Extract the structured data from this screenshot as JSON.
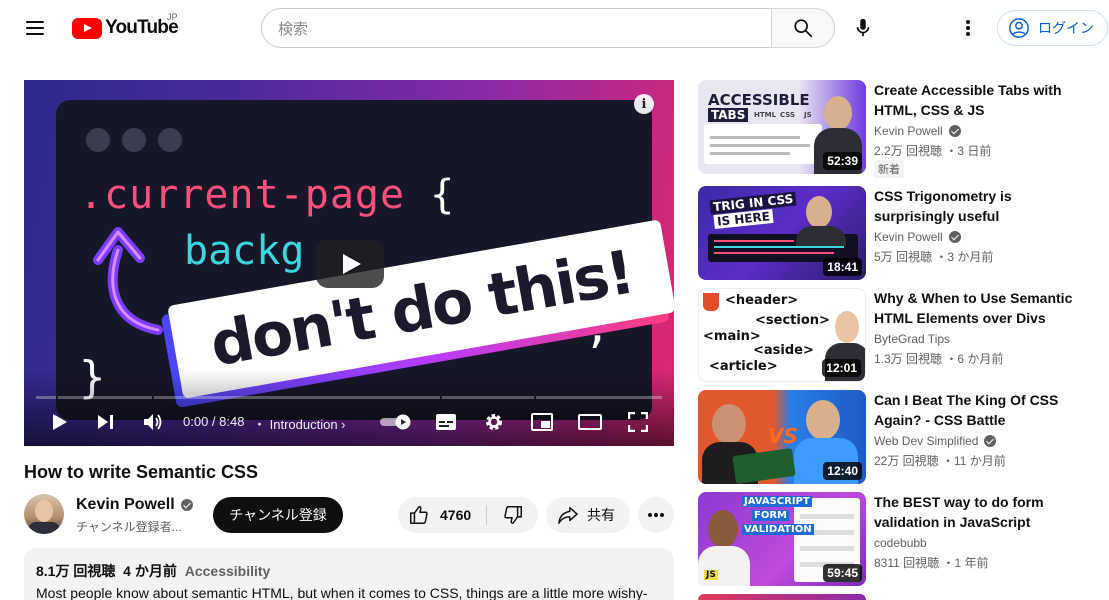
{
  "header": {
    "logo_text": "YouTube",
    "logo_region": "JP",
    "search_placeholder": "検索",
    "login_label": "ログイン"
  },
  "player": {
    "code_line1": ".current-page",
    "code_brace_open": "{",
    "code_line2": "backg",
    "code_semicolon": ";",
    "code_brace_close": "}",
    "banner_text": "don't do this!",
    "time_current": "0:00",
    "time_total": "8:48",
    "time_display": "0:00 / 8:48",
    "chapter": "Introduction",
    "info_label": "i",
    "progress_fraction": 0
  },
  "video": {
    "title": "How to write Semantic CSS",
    "channel_name": "Kevin Powell",
    "channel_subs": "チャンネル登録者...",
    "subscribe_label": "チャンネル登録",
    "likes": "4760",
    "share_label": "共有",
    "views": "8.1万 回視聴",
    "age": "4 か月前",
    "tag": "Accessibility",
    "description": "Most people know about semantic HTML, but when it comes to CSS, things are a little more wishy-"
  },
  "recommendations": [
    {
      "title": "Create Accessible Tabs with HTML, CSS & JS",
      "channel": "Kevin Powell",
      "verified": true,
      "meta": "2.2万 回視聴 ・3 日前",
      "badge": "新着",
      "duration": "52:39",
      "thumb_text": [
        "ACCESSIBLE",
        "TABS",
        "HTML",
        "CSS",
        "JS"
      ]
    },
    {
      "title": "CSS Trigonometry is surprisingly useful",
      "channel": "Kevin Powell",
      "verified": true,
      "meta": "5万 回視聴 ・3 か月前",
      "duration": "18:41",
      "thumb_text": [
        "TRIG IN CSS",
        "IS HERE"
      ]
    },
    {
      "title": "Why & When to Use Semantic HTML Elements over Divs",
      "channel": "ByteGrad Tips",
      "verified": false,
      "meta": "1.3万 回視聴 ・6 か月前",
      "duration": "12:01",
      "thumb_text": [
        "<header>",
        "<section>",
        "<main>",
        "<aside>",
        "<article>"
      ]
    },
    {
      "title": "Can I Beat The King Of CSS Again? - CSS Battle",
      "channel": "Web Dev Simplified",
      "verified": true,
      "meta": "22万 回視聴 ・11 か月前",
      "duration": "12:40",
      "thumb_text": [
        "VS"
      ]
    },
    {
      "title": "The BEST way to do form validation in JavaScript",
      "channel": "codebubb",
      "verified": false,
      "meta": "8311 回視聴 ・1 年前",
      "duration": "59:45",
      "thumb_text": [
        "JAVASCRIPT",
        "FORM",
        "VALIDATION",
        "JS"
      ]
    }
  ],
  "colors": {
    "brand_red": "#ff0000",
    "link_blue": "#065fd4",
    "text_secondary": "#606060",
    "chip_bg": "#f2f2f2"
  },
  "icons": [
    "menu-icon",
    "search-icon",
    "mic-icon",
    "more-vert-icon",
    "account-icon",
    "play-icon",
    "next-icon",
    "volume-icon",
    "autoplay-toggle",
    "subtitles-icon",
    "settings-icon",
    "miniplayer-icon",
    "theater-icon",
    "fullscreen-icon",
    "like-icon",
    "dislike-icon",
    "share-icon",
    "more-horiz-icon",
    "verified-icon"
  ]
}
